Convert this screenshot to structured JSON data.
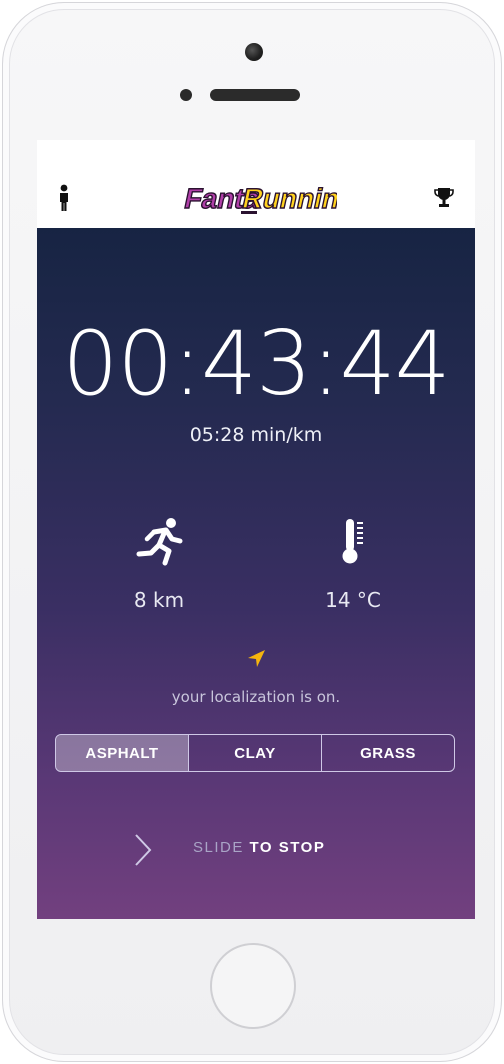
{
  "header": {
    "logo_text_part1": "Fanta",
    "logo_text_part2": "Running",
    "logo_icon": "fantarunning-logo",
    "left_icon": "person-icon",
    "right_icon": "trophy-icon"
  },
  "run": {
    "elapsed_time": "00:43:44",
    "pace": "05:28 min/km",
    "distance": "8 km",
    "temperature": "14 °C",
    "distance_icon": "runner-icon",
    "temperature_icon": "thermometer-icon"
  },
  "location": {
    "icon": "location-arrow-icon",
    "status_text": "your localization is on."
  },
  "surface": {
    "options": [
      "ASPHALT",
      "CLAY",
      "GRASS"
    ],
    "selected": "ASPHALT"
  },
  "slide": {
    "label_prefix": "SLIDE",
    "label_emphasis": "TO STOP"
  },
  "colors": {
    "header_bg": "#ffffff",
    "gradient_top": "#172443",
    "gradient_bottom": "#72407f",
    "logo_fill": "#b03fa8",
    "logo_accent": "#ffd21f",
    "location_arrow": "#f5b50e"
  }
}
